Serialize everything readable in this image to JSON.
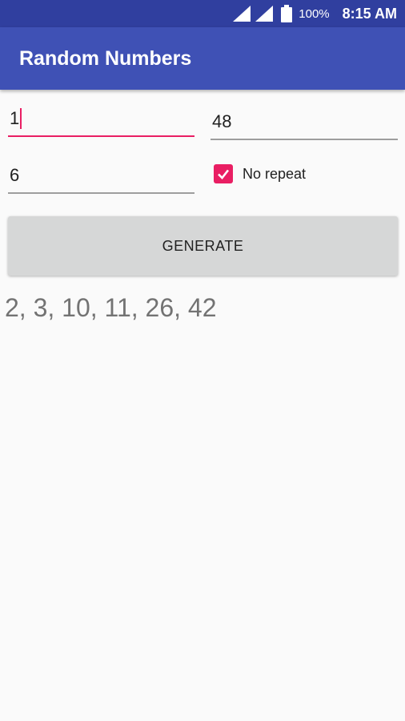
{
  "status_bar": {
    "icons": [
      "signal-icon",
      "signal-icon",
      "battery-icon"
    ],
    "battery": "100%",
    "time": "8:15 AM"
  },
  "app_bar": {
    "title": "Random Numbers"
  },
  "form": {
    "min_value": "1",
    "max_value": "48",
    "count_value": "6",
    "no_repeat_label": "No repeat",
    "no_repeat_checked": true,
    "generate_label": "GENERATE"
  },
  "result": {
    "text": "2, 3, 10, 11, 26, 42"
  },
  "colors": {
    "status_bar": "#303f9f",
    "primary": "#3f51b5",
    "accent": "#e91e63",
    "button": "#d6d7d7",
    "background": "#fafafa"
  }
}
